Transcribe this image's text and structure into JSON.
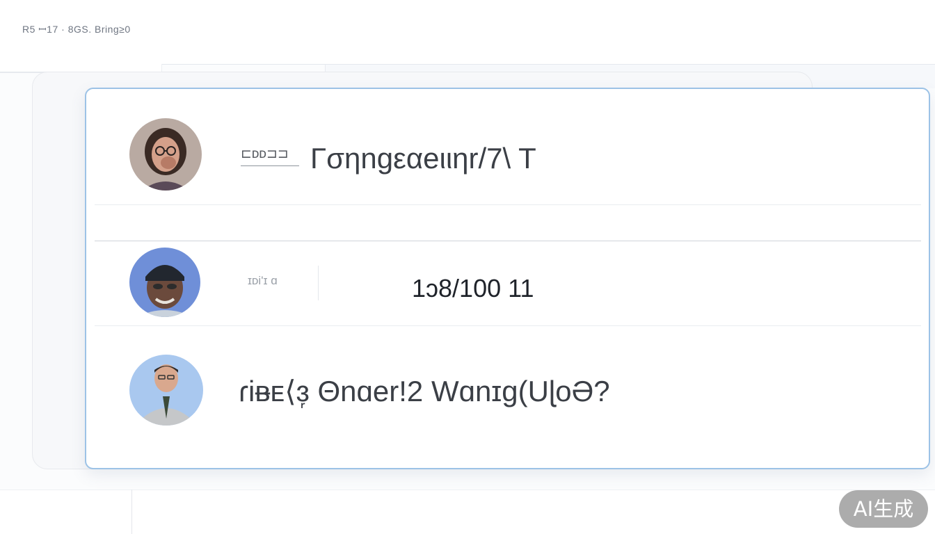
{
  "header": {
    "breadcrumb": "R5  ꟷ17 · 8GS.  Bring≥0"
  },
  "contacts": [
    {
      "avatar_icon": "avatar-woman-glasses-icon",
      "tag": "⊏ᴅᴅ⊐⊐",
      "text": "Γσηngεαeιιηr/7\\ T"
    },
    {
      "avatar_icon": "avatar-man-cap-icon",
      "tag": "ɪᴅi'ɪ ɑ",
      "text": "1ɔ8/100 11"
    },
    {
      "avatar_icon": "avatar-man-suit-icon",
      "tag": "",
      "text": "ɾiᴃᴇ⟨ɜ᷊  Θnɑer!2 Wɑnɪɡ(UɭoƏ?"
    }
  ],
  "watermark": {
    "label": "AI生成"
  },
  "colors": {
    "card_border": "#9cc2e6",
    "divider": "#e9ecf0",
    "text": "#3b3f46",
    "watermark_bg": "#8c8c8c"
  }
}
